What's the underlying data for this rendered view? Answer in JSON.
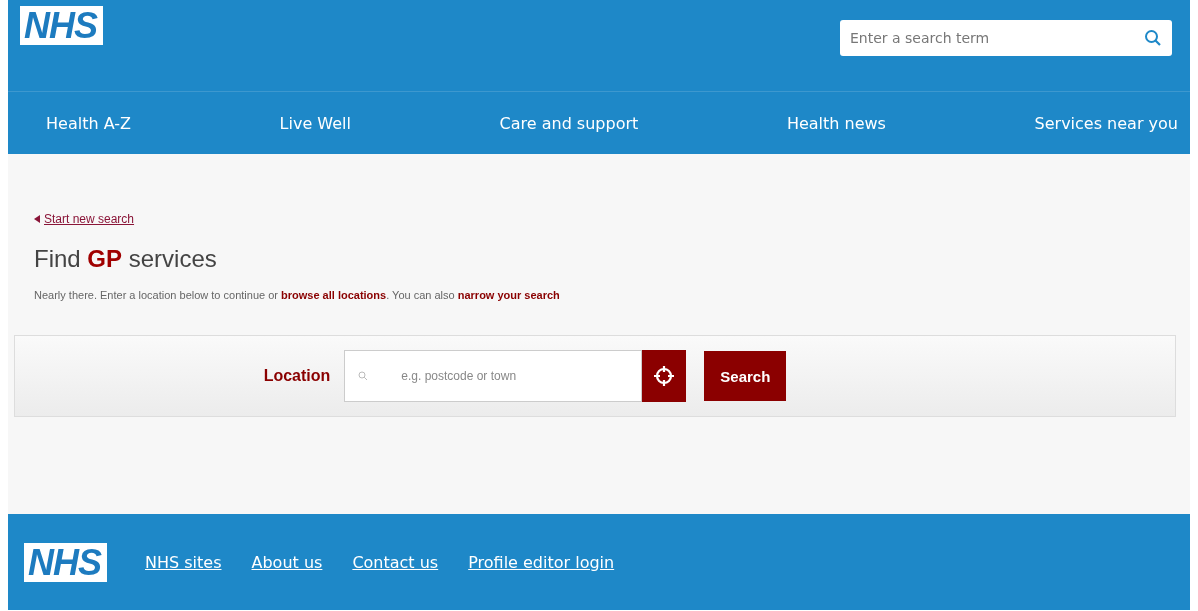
{
  "header": {
    "logo": "NHS",
    "search": {
      "placeholder": "Enter a search term"
    },
    "nav": [
      {
        "label": "Health A-Z"
      },
      {
        "label": "Live Well"
      },
      {
        "label": "Care and support"
      },
      {
        "label": "Health news"
      },
      {
        "label": "Services near you"
      }
    ]
  },
  "main": {
    "back_link": "Start new search",
    "heading": "Find **GP** services",
    "intro": [
      {
        "kind": "text",
        "text": "Nearly there. Enter a location below to continue or "
      },
      {
        "kind": "link",
        "text": "browse all locations"
      },
      {
        "kind": "text",
        "text": ". You can also "
      },
      {
        "kind": "link",
        "text": "narrow your search"
      }
    ],
    "location": {
      "label": "Location",
      "placeholder": "e.g. postcode or town",
      "button": "Search"
    }
  },
  "footer": {
    "logo": "NHS",
    "links": [
      {
        "label": "NHS sites"
      },
      {
        "label": "About us"
      },
      {
        "label": "Contact us"
      },
      {
        "label": "Profile editor login"
      }
    ]
  }
}
